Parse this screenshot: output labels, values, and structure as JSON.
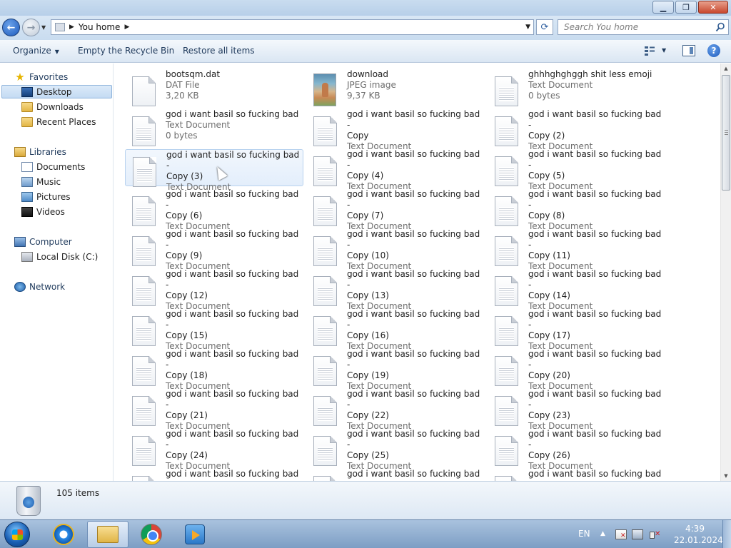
{
  "address": {
    "path_segment": "You home",
    "search_placeholder": "Search You home"
  },
  "toolbar": {
    "organize": "Organize",
    "empty_bin": "Empty the Recycle Bin",
    "restore_all": "Restore all items"
  },
  "nav": {
    "favorites": "Favorites",
    "desktop": "Desktop",
    "downloads": "Downloads",
    "recent_places": "Recent Places",
    "libraries": "Libraries",
    "documents": "Documents",
    "music": "Music",
    "pictures": "Pictures",
    "videos": "Videos",
    "computer": "Computer",
    "local_disk": "Local Disk (C:)",
    "network": "Network"
  },
  "files": [
    {
      "name": "bootsqm.dat",
      "type": "DAT File",
      "size": "3,20 KB",
      "icon": "dat-file-icon"
    },
    {
      "name": "download",
      "type": "JPEG image",
      "size": "9,37 KB",
      "icon": "jpeg-image-icon"
    },
    {
      "name": "ghhhghghggh shit less emoji",
      "type": "Text Document",
      "size": "0 bytes",
      "icon": "text-document-icon"
    },
    {
      "name": "god i want basil so fucking bad",
      "type": "Text Document",
      "size": "0 bytes",
      "icon": "text-document-icon"
    },
    {
      "name": "god i want basil so fucking bad -\nCopy",
      "type": "Text Document",
      "icon": "text-document-icon"
    },
    {
      "name": "god i want basil so fucking bad -\nCopy (2)",
      "type": "Text Document",
      "icon": "text-document-icon"
    },
    {
      "name": "god i want basil so fucking bad -\nCopy (3)",
      "type": "Text Document",
      "icon": "text-document-icon"
    },
    {
      "name": "god i want basil so fucking bad -\nCopy (4)",
      "type": "Text Document",
      "icon": "text-document-icon"
    },
    {
      "name": "god i want basil so fucking bad -\nCopy (5)",
      "type": "Text Document",
      "icon": "text-document-icon"
    },
    {
      "name": "god i want basil so fucking bad -\nCopy (6)",
      "type": "Text Document",
      "icon": "text-document-icon"
    },
    {
      "name": "god i want basil so fucking bad -\nCopy (7)",
      "type": "Text Document",
      "icon": "text-document-icon"
    },
    {
      "name": "god i want basil so fucking bad -\nCopy (8)",
      "type": "Text Document",
      "icon": "text-document-icon"
    },
    {
      "name": "god i want basil so fucking bad -\nCopy (9)",
      "type": "Text Document",
      "icon": "text-document-icon"
    },
    {
      "name": "god i want basil so fucking bad -\nCopy (10)",
      "type": "Text Document",
      "icon": "text-document-icon"
    },
    {
      "name": "god i want basil so fucking bad -\nCopy (11)",
      "type": "Text Document",
      "icon": "text-document-icon"
    },
    {
      "name": "god i want basil so fucking bad -\nCopy (12)",
      "type": "Text Document",
      "icon": "text-document-icon"
    },
    {
      "name": "god i want basil so fucking bad -\nCopy (13)",
      "type": "Text Document",
      "icon": "text-document-icon"
    },
    {
      "name": "god i want basil so fucking bad -\nCopy (14)",
      "type": "Text Document",
      "icon": "text-document-icon"
    },
    {
      "name": "god i want basil so fucking bad -\nCopy (15)",
      "type": "Text Document",
      "icon": "text-document-icon"
    },
    {
      "name": "god i want basil so fucking bad -\nCopy (16)",
      "type": "Text Document",
      "icon": "text-document-icon"
    },
    {
      "name": "god i want basil so fucking bad -\nCopy (17)",
      "type": "Text Document",
      "icon": "text-document-icon"
    },
    {
      "name": "god i want basil so fucking bad -\nCopy (18)",
      "type": "Text Document",
      "icon": "text-document-icon"
    },
    {
      "name": "god i want basil so fucking bad -\nCopy (19)",
      "type": "Text Document",
      "icon": "text-document-icon"
    },
    {
      "name": "god i want basil so fucking bad -\nCopy (20)",
      "type": "Text Document",
      "icon": "text-document-icon"
    },
    {
      "name": "god i want basil so fucking bad -\nCopy (21)",
      "type": "Text Document",
      "icon": "text-document-icon"
    },
    {
      "name": "god i want basil so fucking bad -\nCopy (22)",
      "type": "Text Document",
      "icon": "text-document-icon"
    },
    {
      "name": "god i want basil so fucking bad -\nCopy (23)",
      "type": "Text Document",
      "icon": "text-document-icon"
    },
    {
      "name": "god i want basil so fucking bad -\nCopy (24)",
      "type": "Text Document",
      "icon": "text-document-icon"
    },
    {
      "name": "god i want basil so fucking bad -\nCopy (25)",
      "type": "Text Document",
      "icon": "text-document-icon"
    },
    {
      "name": "god i want basil so fucking bad -\nCopy (26)",
      "type": "Text Document",
      "icon": "text-document-icon"
    },
    {
      "name": "god i want basil so fucking bad -",
      "type": "",
      "icon": "text-document-icon"
    },
    {
      "name": "god i want basil so fucking bad -",
      "type": "",
      "icon": "text-document-icon"
    },
    {
      "name": "god i want basil so fucking bad -",
      "type": "",
      "icon": "text-document-icon"
    }
  ],
  "details": {
    "item_count": "105 items"
  },
  "taskbar": {
    "language": "EN",
    "time": "4:39",
    "date": "22.01.2024"
  }
}
